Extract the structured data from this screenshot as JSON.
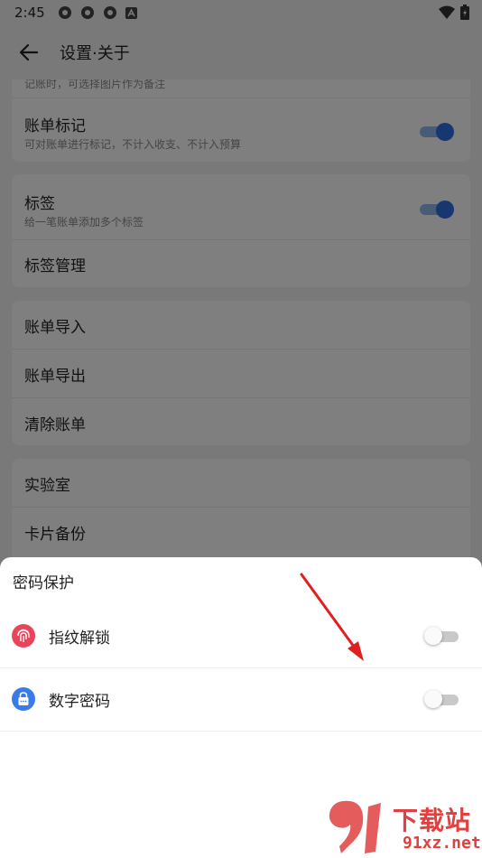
{
  "status_bar": {
    "time": "2:45"
  },
  "app_bar": {
    "title": "设置·关于"
  },
  "cards": {
    "partial_row_text": "记账时，可选择图片作为备注",
    "bill_mark": {
      "title": "账单标记",
      "subtitle": "可对账单进行标记，不计入收支、不计入预算",
      "enabled": true
    },
    "tags": {
      "title": "标签",
      "subtitle": "给一笔账单添加多个标签",
      "enabled": true
    },
    "tag_manage": "标签管理",
    "import": "账单导入",
    "export": "账单导出",
    "clear": "清除账单",
    "lab": "实验室",
    "card_backup": "卡片备份"
  },
  "sheet": {
    "title": "密码保护",
    "fingerprint": {
      "label": "指纹解锁",
      "enabled": false,
      "icon": "fingerprint-icon",
      "color": "#e8455a"
    },
    "pin": {
      "label": "数字密码",
      "enabled": false,
      "icon": "lock-icon",
      "color": "#3b7be8"
    }
  },
  "watermark": {
    "text": "下载站",
    "domain": "91xz.net"
  },
  "colors": {
    "accent": "#2f6fe0",
    "arrow": "#e02020"
  }
}
